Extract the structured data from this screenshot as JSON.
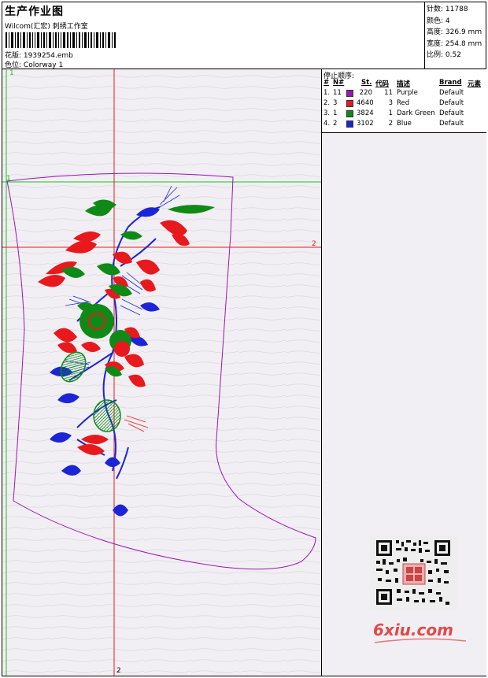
{
  "header": {
    "title": "生产作业图",
    "company": "Wilcom(汇宏) 刺绣工作室",
    "design_file_label": "花版:",
    "design_file": "1939254.emb",
    "colorway_label": "色位:",
    "colorway": "Colorway 1"
  },
  "stats": {
    "stitches_label": "针数:",
    "stitches": "11788",
    "colors_label": "颜色:",
    "colors": "4",
    "height_label": "高度:",
    "height": "326.9 mm",
    "width_label": "宽度:",
    "width": "254.8 mm",
    "scale_label": "比例:",
    "scale": "0.52"
  },
  "stop_sequence": {
    "title": "停止顺序:",
    "columns": [
      "#",
      "N#",
      "St.",
      "代码",
      "描述",
      "Brand",
      "元素"
    ],
    "rows": [
      {
        "idx": "1.",
        "n": "11",
        "color": "#9b16b4",
        "st": "220",
        "code": "11",
        "desc": "Purple",
        "brand": "Default"
      },
      {
        "idx": "2.",
        "n": "3",
        "color": "#e8191d",
        "st": "4640",
        "code": "3",
        "desc": "Red",
        "brand": "Default"
      },
      {
        "idx": "3.",
        "n": "1",
        "color": "#0f8a17",
        "st": "3824",
        "code": "1",
        "desc": "Dark Green",
        "brand": "Default"
      },
      {
        "idx": "4.",
        "n": "2",
        "color": "#1c25d6",
        "st": "3102",
        "code": "2",
        "desc": "Blue",
        "brand": "Default"
      }
    ]
  },
  "design": {
    "axis_labels": {
      "v_top": "1",
      "v_bottom": "2",
      "h_left": "1",
      "h_right": "2"
    },
    "outline_color": "#9b16b4",
    "guide_green": "#19c419",
    "guide_red": "#e8191d"
  },
  "watermark": {
    "logo_text": "6xiu.com"
  }
}
